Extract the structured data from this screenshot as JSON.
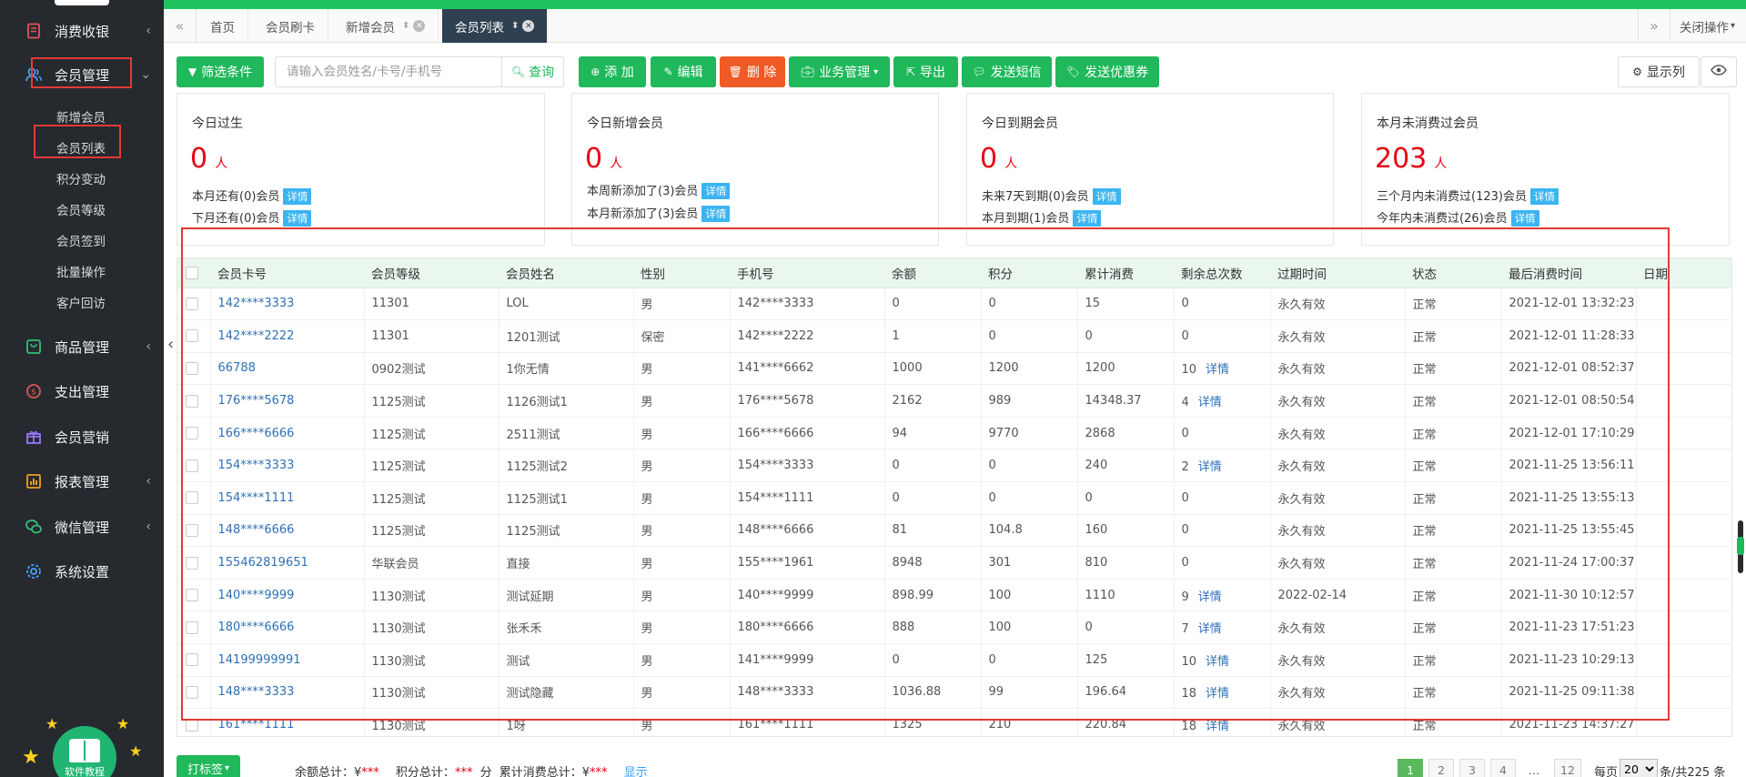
{
  "sidebar": {
    "menu": [
      {
        "name": "menu-consume-cashier",
        "label": "消费收银",
        "icon": "receipt-icon",
        "has_arrow": true
      },
      {
        "name": "menu-member-management",
        "label": "会员管理",
        "icon": "members-icon",
        "has_arrow": true
      },
      {
        "name": "menu-goods-management",
        "label": "商品管理",
        "icon": "goods-icon",
        "has_arrow": true
      },
      {
        "name": "menu-expense-management",
        "label": "支出管理",
        "icon": "coin-icon",
        "has_arrow": false
      },
      {
        "name": "menu-member-marketing",
        "label": "会员营销",
        "icon": "gift-icon",
        "has_arrow": false
      },
      {
        "name": "menu-report-management",
        "label": "报表管理",
        "icon": "report-icon",
        "has_arrow": true
      },
      {
        "name": "menu-wechat-management",
        "label": "微信管理",
        "icon": "wechat-icon",
        "has_arrow": true
      },
      {
        "name": "menu-system-settings",
        "label": "系统设置",
        "icon": "settings-icon",
        "has_arrow": false
      }
    ],
    "submenu": [
      "新增会员",
      "会员列表",
      "积分变动",
      "会员等级",
      "会员签到",
      "批量操作",
      "客户回访"
    ],
    "help_label": "软件教程"
  },
  "tabs": {
    "items": [
      {
        "label": "首页",
        "active": false,
        "closable": false
      },
      {
        "label": "会员刷卡",
        "active": false,
        "closable": false
      },
      {
        "label": "新增会员",
        "active": false,
        "closable": true
      },
      {
        "label": "会员列表",
        "active": true,
        "closable": true
      }
    ],
    "close_ops_label": "关闭操作"
  },
  "toolbar": {
    "filter_label": "筛选条件",
    "search_placeholder": "请输入会员姓名/卡号/手机号",
    "query_label": "查询",
    "add_label": "添 加",
    "edit_label": "编辑",
    "delete_label": "删 除",
    "business_label": "业务管理",
    "export_label": "导出",
    "sms_label": "发送短信",
    "coupon_label": "发送优惠券",
    "columns_label": "显示列"
  },
  "stats": [
    {
      "title": "今日过生",
      "value": "0",
      "unit": "人",
      "lines": [
        {
          "text": "本月还有(0)会员",
          "link": "详情"
        },
        {
          "text": "下月还有(0)会员",
          "link": "详情"
        }
      ]
    },
    {
      "title": "今日新增会员",
      "value": "0",
      "unit": "人",
      "lines": [
        {
          "text": "本周新添加了(3)会员",
          "link": "详情"
        },
        {
          "text": "本月新添加了(3)会员",
          "link": "详情"
        }
      ]
    },
    {
      "title": "今日到期会员",
      "value": "0",
      "unit": "人",
      "lines": [
        {
          "text": "未来7天到期(0)会员",
          "link": "详情"
        },
        {
          "text": "本月到期(1)会员",
          "link": "详情"
        }
      ]
    },
    {
      "title": "本月未消费过会员",
      "value": "203",
      "unit": "人",
      "lines": [
        {
          "text": "三个月内未消费过(123)会员",
          "link": "详情"
        },
        {
          "text": "今年内未消费过(26)会员",
          "link": "详情"
        }
      ]
    }
  ],
  "table": {
    "headers": [
      "会员卡号",
      "会员等级",
      "会员姓名",
      "性别",
      "手机号",
      "余额",
      "积分",
      "累计消费",
      "剩余总次数",
      "过期时间",
      "状态",
      "最后消费时间",
      "日期"
    ],
    "detail_label": "详情",
    "rows": [
      {
        "card": "142****3333",
        "level": "11301",
        "name": "LOL",
        "gender": "男",
        "phone": "142****3333",
        "balance": "0",
        "points": "0",
        "total": "15",
        "times": "0",
        "detail": false,
        "expire": "永久有效",
        "status": "正常",
        "last": "2021-12-01 13:32:23"
      },
      {
        "card": "142****2222",
        "level": "11301",
        "name": "1201测试",
        "gender": "保密",
        "phone": "142****2222",
        "balance": "1",
        "points": "0",
        "total": "0",
        "times": "0",
        "detail": false,
        "expire": "永久有效",
        "status": "正常",
        "last": "2021-12-01 11:28:33"
      },
      {
        "card": "66788",
        "level": "0902测试",
        "name": "1你无情",
        "gender": "男",
        "phone": "141****6662",
        "balance": "1000",
        "points": "1200",
        "total": "1200",
        "times": "10",
        "detail": true,
        "expire": "永久有效",
        "status": "正常",
        "last": "2021-12-01 08:52:37"
      },
      {
        "card": "176****5678",
        "level": "1125测试",
        "name": "1126测试1",
        "gender": "男",
        "phone": "176****5678",
        "balance": "2162",
        "points": "989",
        "total": "14348.37",
        "times": "4",
        "detail": true,
        "expire": "永久有效",
        "status": "正常",
        "last": "2021-12-01 08:50:54"
      },
      {
        "card": "166****6666",
        "level": "1125测试",
        "name": "2511测试",
        "gender": "男",
        "phone": "166****6666",
        "balance": "94",
        "points": "9770",
        "total": "2868",
        "times": "0",
        "detail": false,
        "expire": "永久有效",
        "status": "正常",
        "last": "2021-12-01 17:10:29"
      },
      {
        "card": "154****3333",
        "level": "1125测试",
        "name": "1125测试2",
        "gender": "男",
        "phone": "154****3333",
        "balance": "0",
        "points": "0",
        "total": "240",
        "times": "2",
        "detail": true,
        "expire": "永久有效",
        "status": "正常",
        "last": "2021-11-25 13:56:11"
      },
      {
        "card": "154****1111",
        "level": "1125测试",
        "name": "1125测试1",
        "gender": "男",
        "phone": "154****1111",
        "balance": "0",
        "points": "0",
        "total": "0",
        "times": "0",
        "detail": false,
        "expire": "永久有效",
        "status": "正常",
        "last": "2021-11-25 13:55:13"
      },
      {
        "card": "148****6666",
        "level": "1125测试",
        "name": "1125测试",
        "gender": "男",
        "phone": "148****6666",
        "balance": "81",
        "points": "104.8",
        "total": "160",
        "times": "0",
        "detail": false,
        "expire": "永久有效",
        "status": "正常",
        "last": "2021-11-25 13:55:45"
      },
      {
        "card": "155462819651",
        "level": "华联会员",
        "name": "直接",
        "gender": "男",
        "phone": "155****1961",
        "balance": "8948",
        "points": "301",
        "total": "810",
        "times": "0",
        "detail": false,
        "expire": "永久有效",
        "status": "正常",
        "last": "2021-11-24 17:00:37"
      },
      {
        "card": "140****9999",
        "level": "1130测试",
        "name": "测试延期",
        "gender": "男",
        "phone": "140****9999",
        "balance": "898.99",
        "points": "100",
        "total": "1110",
        "times": "9",
        "detail": true,
        "expire": "2022-02-14",
        "status": "正常",
        "last": "2021-11-30 10:12:57"
      },
      {
        "card": "180****6666",
        "level": "1130测试",
        "name": "张禾禾",
        "gender": "男",
        "phone": "180****6666",
        "balance": "888",
        "points": "100",
        "total": "0",
        "times": "7",
        "detail": true,
        "expire": "永久有效",
        "status": "正常",
        "last": "2021-11-23 17:51:23"
      },
      {
        "card": "14199999991",
        "level": "1130测试",
        "name": "测试",
        "gender": "男",
        "phone": "141****9999",
        "balance": "0",
        "points": "0",
        "total": "125",
        "times": "10",
        "detail": true,
        "expire": "永久有效",
        "status": "正常",
        "last": "2021-11-23 10:29:13"
      },
      {
        "card": "148****3333",
        "level": "1130测试",
        "name": "测试隐藏",
        "gender": "男",
        "phone": "148****3333",
        "balance": "1036.88",
        "points": "99",
        "total": "196.64",
        "times": "18",
        "detail": true,
        "expire": "永久有效",
        "status": "正常",
        "last": "2021-11-25 09:11:38"
      },
      {
        "card": "161****1111",
        "level": "1130测试",
        "name": "1呀",
        "gender": "男",
        "phone": "161****1111",
        "balance": "1325",
        "points": "210",
        "total": "220.84",
        "times": "18",
        "detail": true,
        "expire": "永久有效",
        "status": "正常",
        "last": "2021-11-23 14:37:27"
      }
    ]
  },
  "footer": {
    "tag_label": "打标签",
    "balance_total_label": "余额总计：¥",
    "balance_total_value": "***",
    "points_total_label": "积分总计：",
    "points_total_value": "***",
    "points_unit": "分",
    "consume_total_label": "累计消费总计：¥",
    "consume_total_value": "***",
    "show_label": "显示",
    "pages": [
      "1",
      "2",
      "3",
      "4",
      "…",
      "12"
    ],
    "per_page_prefix": "每页",
    "per_page_value": "20",
    "per_page_suffix": "条/共225 条"
  },
  "colors": {
    "accent": "#1fb85a",
    "danger": "#f05a26",
    "highlight_box": "#e53935",
    "sidebar_bg": "#262a2f",
    "active_tab": "#2f4050"
  }
}
